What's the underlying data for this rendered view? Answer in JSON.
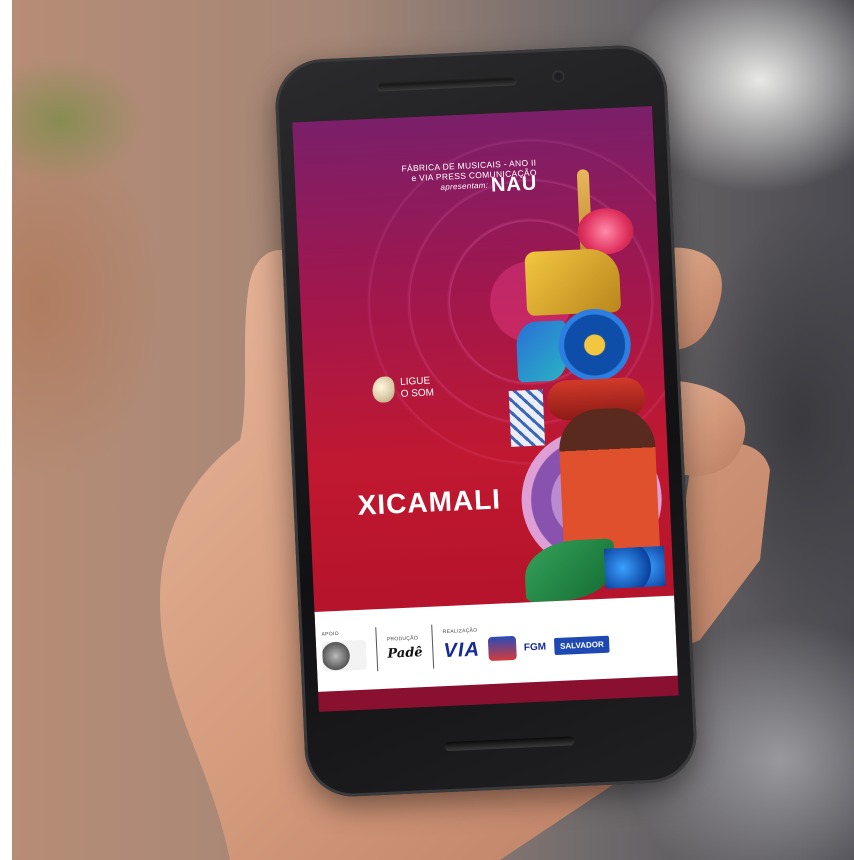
{
  "poster": {
    "line1": "FÁBRICA DE MUSICAIS - ANO II",
    "line2": "e VIA PRESS COMUNICAÇÃO",
    "line3_prefix": "apresentam:",
    "line3_name": "NAU",
    "ligue_line1": "LIGUE",
    "ligue_line2": "O SOM",
    "title": "XICAMALI"
  },
  "sponsors": {
    "apoio_label": "APOIO",
    "producao_label": "PRODUÇÃO",
    "realizacao_label": "REALIZAÇÃO",
    "via_text": "VIA",
    "fgm_text": "FGM",
    "salvador_text": "SALVADOR"
  }
}
